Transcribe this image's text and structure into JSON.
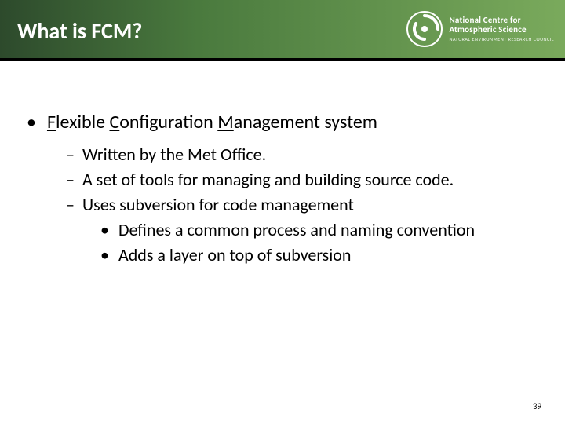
{
  "header": {
    "title": "What is FCM?",
    "org": {
      "line1a": "National Centre for",
      "line1b": "Atmospheric Science",
      "line2": "NATURAL ENVIRONMENT RESEARCH COUNCIL"
    }
  },
  "bullet": {
    "word1_initial": "F",
    "word1_rest": "lexible ",
    "word2_initial": "C",
    "word2_rest": "onfiguration ",
    "word3_initial": "M",
    "word3_rest": "anagement system"
  },
  "dashes": [
    "Written by the Met Office.",
    "A set of tools for managing and building source code.",
    "Uses subversion for code management"
  ],
  "subdots": [
    "Defines a common process and naming convention",
    "Adds a layer on top of subversion"
  ],
  "page": "39"
}
